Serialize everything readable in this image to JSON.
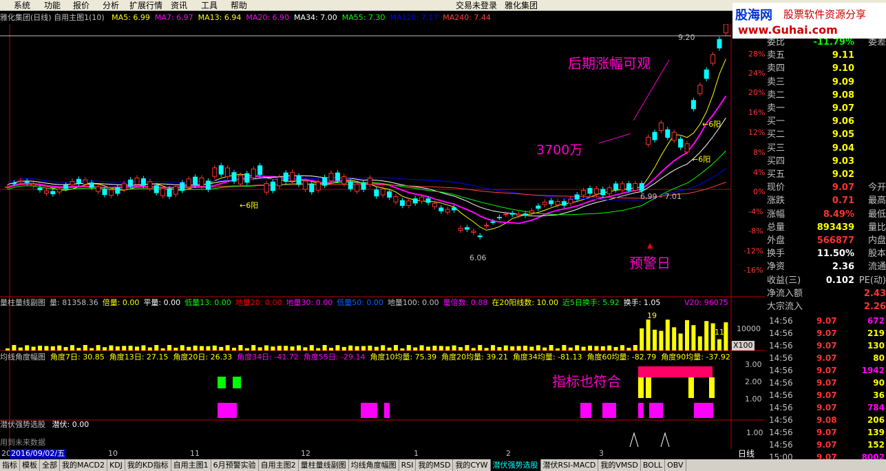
{
  "menu": {
    "items": [
      "系统",
      "功能",
      "报价",
      "分析",
      "扩展行情",
      "资讯",
      "工具",
      "帮助"
    ],
    "title": "交易未登录",
    "stock": "雅化集团"
  },
  "logo": {
    "brand": "股海网",
    "slogan": "股票软件资源分享",
    "url": "www.Guhai.com"
  },
  "header": {
    "title": "雅化集团(日线) 自用主图1(10)",
    "ma": [
      {
        "label": "MA5: 6.99",
        "color": "#ffff00"
      },
      {
        "label": "MA7: 6.97",
        "color": "#ff00ff"
      },
      {
        "label": "MA13: 6.94",
        "color": "#ffff00"
      },
      {
        "label": "MA20: 6.90",
        "color": "#ff00ff"
      },
      {
        "label": "MA34: 7.00",
        "color": "#ffffff"
      },
      {
        "label": "MA55: 7.30",
        "color": "#00ff00"
      },
      {
        "label": "MA120: 7.17",
        "color": "#0000ff"
      },
      {
        "label": "MA240: 7.44",
        "color": "#ff4040"
      }
    ]
  },
  "price_axis": [
    "28%",
    "24%",
    "20%",
    "16%",
    "12%",
    "8%",
    "4%",
    "0%",
    "-4%",
    "-8%",
    "-12%",
    "-16%"
  ],
  "price_labels": {
    "high": "9.20",
    "low": "6.06",
    "ma_note": "6.99 - 7.01",
    "yang1": "←6阳",
    "yang2": "←6阳",
    "yang3": "←6阳"
  },
  "annotations": {
    "later": "后期涨幅可观",
    "money": "3700万",
    "warn": "预警日",
    "indicator": "指标也符合"
  },
  "vol_header": [
    {
      "t": "量柱量线副图",
      "c": "#c0c0c0"
    },
    {
      "t": "量: 81358.36",
      "c": "#c0c0c0"
    },
    {
      "t": "倍量: 0.00",
      "c": "#ffff00"
    },
    {
      "t": "平量: 0.00",
      "c": "#ffffff"
    },
    {
      "t": "低量13: 0.00",
      "c": "#00ff00"
    },
    {
      "t": "地量20: 0.00",
      "c": "#ff0000"
    },
    {
      "t": "地量30: 0.00",
      "c": "#ff00ff"
    },
    {
      "t": "低量50: 0.00",
      "c": "#0066ff"
    },
    {
      "t": "地量100: 0.00",
      "c": "#c0c0c0"
    },
    {
      "t": "量倍数: 0.88",
      "c": "#ff00ff"
    },
    {
      "t": "在20阳线数: 10.00",
      "c": "#ffff00"
    },
    {
      "t": "近5日换手: 5.92",
      "c": "#00ff00"
    },
    {
      "t": "换手: 1.05",
      "c": "#ffffff"
    }
  ],
  "vol_labels": {
    "v20": "V20: 96075",
    "axis": "10000",
    "unit": "X100",
    "n19": "19",
    "n11": "11"
  },
  "angle_header": [
    {
      "t": "均线角度幅图",
      "c": "#c0c0c0"
    },
    {
      "t": "角度7日: 30.85",
      "c": "#ffff00"
    },
    {
      "t": "角度13日: 27.15",
      "c": "#ffff00"
    },
    {
      "t": "角度20日: 26.33",
      "c": "#ffff00"
    },
    {
      "t": "角度34日: -41.72",
      "c": "#ff00ff"
    },
    {
      "t": "角度55日: -29.14",
      "c": "#ff00ff"
    },
    {
      "t": "角度10均量: 75.39",
      "c": "#ffff00"
    },
    {
      "t": "角度20均量: 39.21",
      "c": "#ffff00"
    },
    {
      "t": "角度34均量: -81.13",
      "c": "#ffff00"
    },
    {
      "t": "角度60均量: -82.79",
      "c": "#ffff00"
    },
    {
      "t": "角度90均量: -37.92",
      "c": "#ffff00"
    }
  ],
  "angle_axis": [
    "3.00",
    "2.00",
    "1.00"
  ],
  "qf_header": {
    "name": "潜伏强势选股",
    "value": "潜伏: 0.00",
    "note": "用到未来数据",
    "axis": "1.00"
  },
  "dates": {
    "left": "20",
    "sel": "2016/09/02/五",
    "m10": "10",
    "m11": "11",
    "m12": "12",
    "m1": "1",
    "m2": "2",
    "m3": "3"
  },
  "quote": {
    "wb": {
      "label": "委比",
      "value": "-11.79%",
      "lbl2": "委差"
    },
    "asks": [
      {
        "label": "卖五",
        "price": "9.11"
      },
      {
        "label": "卖四",
        "price": "9.10"
      },
      {
        "label": "卖三",
        "price": "9.09"
      },
      {
        "label": "卖二",
        "price": "9.08"
      },
      {
        "label": "卖一",
        "price": "9.07"
      }
    ],
    "bids": [
      {
        "label": "买一",
        "price": "9.06"
      },
      {
        "label": "买二",
        "price": "9.05"
      },
      {
        "label": "买三",
        "price": "9.04"
      },
      {
        "label": "买四",
        "price": "9.03"
      },
      {
        "label": "买五",
        "price": "9.02"
      }
    ],
    "stats": [
      {
        "label": "现价",
        "value": "9.07",
        "lbl2": "今开",
        "color": "#ff3232"
      },
      {
        "label": "涨跌",
        "value": "0.71",
        "lbl2": "最高",
        "color": "#ff3232"
      },
      {
        "label": "涨幅",
        "value": "8.49%",
        "lbl2": "最低",
        "color": "#ff3232"
      },
      {
        "label": "总量",
        "value": "893439",
        "lbl2": "量比",
        "color": "#ffff00"
      },
      {
        "label": "外盘",
        "value": "566877",
        "lbl2": "内盘",
        "color": "#ff3232"
      },
      {
        "label": "换手",
        "value": "11.50%",
        "lbl2": "股本",
        "color": "#ffffff"
      },
      {
        "label": "净资",
        "value": "2.36",
        "lbl2": "流通",
        "color": "#ffffff"
      },
      {
        "label": "收益(三)",
        "value": "0.102",
        "lbl2": "PE(动)",
        "color": "#ffffff"
      }
    ],
    "flow": [
      {
        "label": "净流入额",
        "value": "2.43"
      },
      {
        "label": "大宗流入",
        "value": "2.26"
      }
    ]
  },
  "ticks": [
    {
      "time": "14:56",
      "price": "9.07",
      "vol": "672",
      "color": "#ff00ff"
    },
    {
      "time": "14:56",
      "price": "9.07",
      "vol": "219",
      "color": "#ffff00"
    },
    {
      "time": "14:56",
      "price": "9.07",
      "vol": "130",
      "color": "#ffff00"
    },
    {
      "time": "14:56",
      "price": "9.07",
      "vol": "80",
      "color": "#ffff00"
    },
    {
      "time": "14:56",
      "price": "9.07",
      "vol": "1942",
      "color": "#ff00ff"
    },
    {
      "time": "14:56",
      "price": "9.07",
      "vol": "90",
      "color": "#ffff00"
    },
    {
      "time": "14:56",
      "price": "9.07",
      "vol": "36",
      "color": "#ffff00"
    },
    {
      "time": "14:56",
      "price": "9.07",
      "vol": "784",
      "color": "#ff00ff"
    },
    {
      "time": "14:56",
      "price": "9.08",
      "vol": "206",
      "color": "#ffff00"
    },
    {
      "time": "14:56",
      "price": "9.07",
      "vol": "139",
      "color": "#ffff00"
    },
    {
      "time": "14:56",
      "price": "9.07",
      "vol": "152",
      "color": "#ffff00"
    },
    {
      "time": "15:00",
      "price": "9.07",
      "vol": "8002",
      "color": "#ff00ff"
    }
  ],
  "period": "日线",
  "tabs": [
    {
      "label": "指标",
      "active": false
    },
    {
      "label": "模板",
      "active": false
    },
    {
      "label": "全部",
      "active": false
    },
    {
      "label": "我的MACD2",
      "active": false
    },
    {
      "label": "KDJ",
      "active": false
    },
    {
      "label": "我的KD指标",
      "active": false
    },
    {
      "label": "自用主图1",
      "active": false
    },
    {
      "label": "6月预警实验",
      "active": false
    },
    {
      "label": "自用主图2",
      "active": false
    },
    {
      "label": "量柱量线副图",
      "active": false
    },
    {
      "label": "均线角度幅图",
      "active": false
    },
    {
      "label": "RSI",
      "active": false
    },
    {
      "label": "我的MSD",
      "active": false
    },
    {
      "label": "我的CYW",
      "active": false
    },
    {
      "label": "潜伏强势选股",
      "active": true
    },
    {
      "label": "潜伏RSI-MACD",
      "active": false
    },
    {
      "label": "我的VMSD",
      "active": false
    },
    {
      "label": "BOLL",
      "active": false
    },
    {
      "label": "OBV",
      "active": false
    }
  ]
}
